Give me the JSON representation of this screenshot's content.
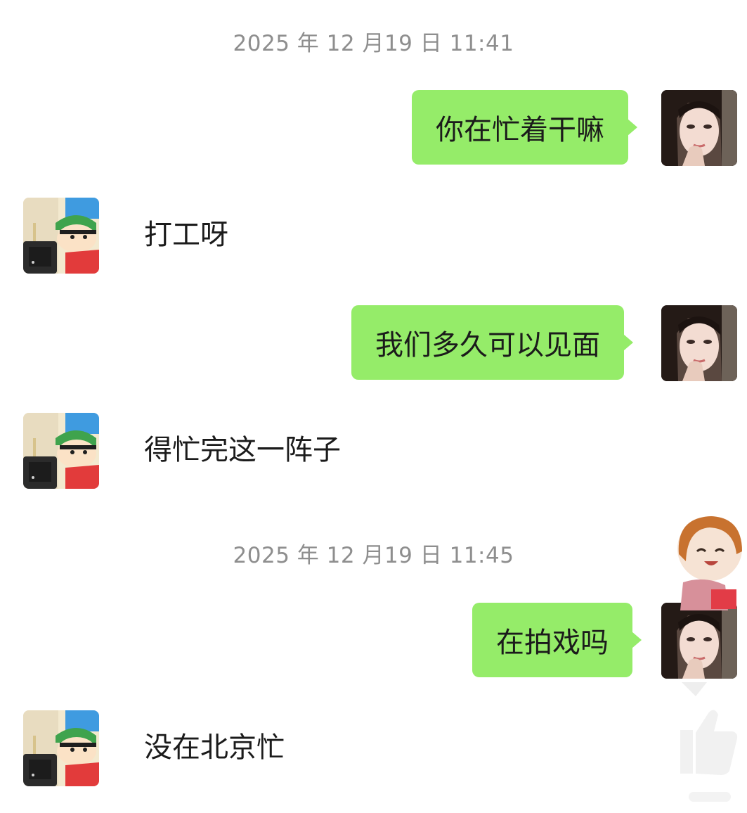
{
  "timestamps": [
    "2025 年 12 月19 日 11:41",
    "2025 年 12 月19 日 11:45"
  ],
  "messages": [
    {
      "side": "outgoing",
      "text": "你在忙着干嘛"
    },
    {
      "side": "incoming",
      "text": "打工呀"
    },
    {
      "side": "outgoing",
      "text": "我们多久可以见面"
    },
    {
      "side": "incoming",
      "text": "得忙完这一阵子"
    },
    {
      "side": "outgoing",
      "text": "在拍戏吗"
    },
    {
      "side": "incoming",
      "text": "没在北京忙"
    }
  ],
  "avatars": {
    "outgoing": "woman-photo-avatar",
    "incoming": "cartoon-boy-avatar"
  },
  "colors": {
    "outgoing_bubble": "#95ec69",
    "timestamp_text": "#8e8e8e",
    "background": "#ffffff"
  }
}
